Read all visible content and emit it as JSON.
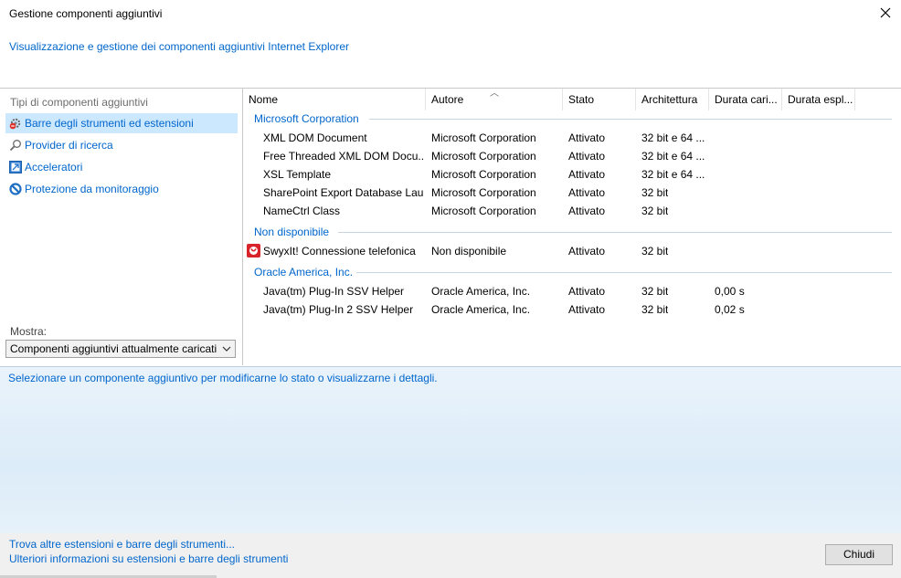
{
  "window": {
    "title": "Gestione componenti aggiuntivi",
    "subtitle": "Visualizzazione e gestione dei componenti aggiuntivi Internet Explorer"
  },
  "sidebar": {
    "header": "Tipi di componenti aggiuntivi",
    "items": [
      {
        "label": "Barre degli strumenti ed estensioni",
        "icon": "gear-block-icon",
        "selected": true
      },
      {
        "label": "Provider di ricerca",
        "icon": "search-icon"
      },
      {
        "label": "Acceleratori",
        "icon": "accelerator-icon"
      },
      {
        "label": "Protezione da monitoraggio",
        "icon": "tracking-protection-icon"
      }
    ],
    "show_label": "Mostra:",
    "show_value": "Componenti aggiuntivi attualmente caricati"
  },
  "table": {
    "columns": [
      "Nome",
      "Autore",
      "Stato",
      "Architettura",
      "Durata cari...",
      "Durata espl..."
    ],
    "groups": [
      {
        "name": "Microsoft Corporation",
        "rows": [
          [
            "XML DOM Document",
            "Microsoft Corporation",
            "Attivato",
            "32 bit e 64 ...",
            "",
            ""
          ],
          [
            "Free Threaded XML DOM Docu...",
            "Microsoft Corporation",
            "Attivato",
            "32 bit e 64 ...",
            "",
            ""
          ],
          [
            "XSL Template",
            "Microsoft Corporation",
            "Attivato",
            "32 bit e 64 ...",
            "",
            ""
          ],
          [
            "SharePoint Export Database Lau...",
            "Microsoft Corporation",
            "Attivato",
            "32 bit",
            "",
            ""
          ],
          [
            "NameCtrl Class",
            "Microsoft Corporation",
            "Attivato",
            "32 bit",
            "",
            ""
          ]
        ]
      },
      {
        "name": "Non disponibile",
        "rows": [
          [
            "SwyxIt! Connessione telefonica",
            "Non disponibile",
            "Attivato",
            "32 bit",
            "",
            ""
          ]
        ]
      },
      {
        "name": "Oracle America, Inc.",
        "rows": [
          [
            "Java(tm) Plug-In SSV Helper",
            "Oracle America, Inc.",
            "Attivato",
            "32 bit",
            "0,00 s",
            ""
          ],
          [
            "Java(tm) Plug-In 2 SSV Helper",
            "Oracle America, Inc.",
            "Attivato",
            "32 bit",
            "0,02 s",
            ""
          ]
        ]
      }
    ]
  },
  "details": {
    "hint": "Selezionare un componente aggiuntivo per modificarne lo stato o visualizzarne i dettagli."
  },
  "footer": {
    "link1": "Trova altre estensioni e barre degli strumenti...",
    "link2": "Ulteriori informazioni su estensioni e barre degli strumenti",
    "close_label": "Chiudi"
  }
}
